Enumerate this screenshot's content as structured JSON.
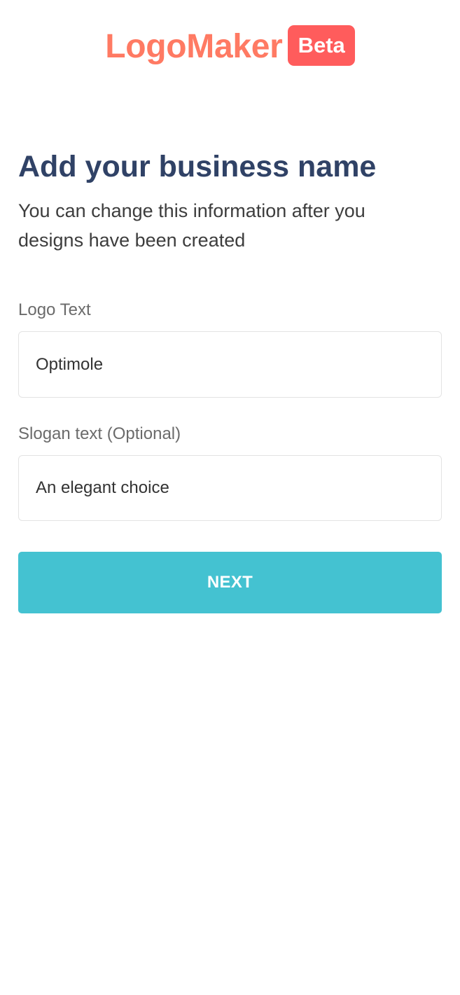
{
  "header": {
    "brand_name": "LogoMaker",
    "badge": "Beta"
  },
  "page": {
    "title": "Add your business name",
    "subtitle": "You can change this information after you designs have been created"
  },
  "form": {
    "logo_text": {
      "label": "Logo Text",
      "value": "Optimole"
    },
    "slogan_text": {
      "label": "Slogan text (Optional)",
      "value": "An elegant choice"
    },
    "next_label": "NEXT"
  },
  "colors": {
    "brand": "#ff7a63",
    "badge": "#ff5c5c",
    "title": "#304266",
    "button": "#44c2d1"
  }
}
